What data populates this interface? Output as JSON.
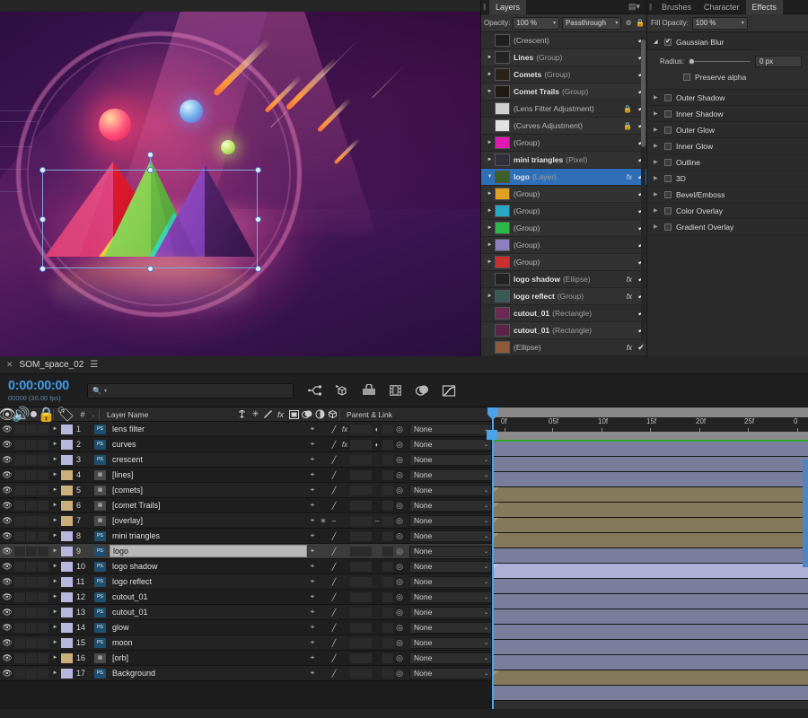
{
  "canvas": {
    "name": "artboard-canvas",
    "selection": {
      "handles": 8,
      "rotation_handle": true
    }
  },
  "layers_panel": {
    "tab": "Layers",
    "menu_icon": "panel-menu-icon",
    "opacity_label": "Opacity:",
    "opacity_value": "100 %",
    "blend_mode": "Passthrough",
    "gear_icon": "gear-icon",
    "lock_icon": "lock-icon",
    "items": [
      {
        "name": "(Crescent)",
        "type": "",
        "bold": false,
        "expandable": false,
        "fx": false,
        "locked": false,
        "checked": "✔",
        "thumb": "#1f1f1f"
      },
      {
        "name": "Lines",
        "type": "(Group)",
        "bold": true,
        "expandable": true,
        "fx": false,
        "locked": false,
        "checked": "✔",
        "thumb": "#242424"
      },
      {
        "name": "Comets",
        "type": "(Group)",
        "bold": true,
        "expandable": true,
        "fx": false,
        "locked": false,
        "checked": "✔",
        "thumb": "#2a2118"
      },
      {
        "name": "Comet Trails",
        "type": "(Group)",
        "bold": true,
        "expandable": true,
        "fx": false,
        "locked": false,
        "checked": "✔",
        "thumb": "#201a14"
      },
      {
        "name": "(Lens Filter Adjustment)",
        "type": "",
        "bold": false,
        "expandable": false,
        "fx": false,
        "locked": true,
        "checked": "✔",
        "thumb": "#cfcfcf"
      },
      {
        "name": "(Curves Adjustment)",
        "type": "",
        "bold": false,
        "expandable": false,
        "fx": false,
        "locked": true,
        "checked": "✔",
        "thumb": "#e2e2e2"
      },
      {
        "name": "(Group)",
        "type": "",
        "bold": false,
        "expandable": true,
        "fx": false,
        "locked": false,
        "checked": "✔",
        "thumb": "#e01ab0"
      },
      {
        "name": "mini triangles",
        "type": "(Pixel)",
        "bold": true,
        "expandable": true,
        "fx": false,
        "locked": false,
        "checked": "✔",
        "thumb": "#30303a"
      },
      {
        "name": "logo",
        "type": "(Layer)",
        "bold": true,
        "expandable": true,
        "fx": true,
        "locked": false,
        "checked": "✔",
        "thumb": "#3b5e2a",
        "selected": true
      },
      {
        "name": "(Group)",
        "type": "",
        "bold": false,
        "expandable": true,
        "fx": false,
        "locked": false,
        "checked": "✔",
        "thumb": "#e0a020"
      },
      {
        "name": "(Group)",
        "type": "",
        "bold": false,
        "expandable": true,
        "fx": false,
        "locked": false,
        "checked": "✔",
        "thumb": "#2aa8c8"
      },
      {
        "name": "(Group)",
        "type": "",
        "bold": false,
        "expandable": true,
        "fx": false,
        "locked": false,
        "checked": "✔",
        "thumb": "#2fb84a"
      },
      {
        "name": "(Group)",
        "type": "",
        "bold": false,
        "expandable": true,
        "fx": false,
        "locked": false,
        "checked": "✔",
        "thumb": "#8b7fc0"
      },
      {
        "name": "(Group)",
        "type": "",
        "bold": false,
        "expandable": true,
        "fx": false,
        "locked": false,
        "checked": "✔",
        "thumb": "#c83030"
      },
      {
        "name": "logo shadow",
        "type": "(Ellipse)",
        "bold": true,
        "expandable": false,
        "fx": true,
        "locked": false,
        "checked": "✔",
        "thumb": "#232323"
      },
      {
        "name": "logo reflect",
        "type": "(Group)",
        "bold": true,
        "expandable": true,
        "fx": true,
        "locked": false,
        "checked": "✔",
        "thumb": "#3a5a58"
      },
      {
        "name": "cutout_01",
        "type": "(Rectangle)",
        "bold": true,
        "expandable": false,
        "fx": false,
        "locked": false,
        "checked": "✔",
        "thumb": "#6b2a52"
      },
      {
        "name": "cutout_01",
        "type": "(Rectangle)",
        "bold": true,
        "expandable": false,
        "fx": false,
        "locked": false,
        "checked": "✔",
        "thumb": "#5a2448"
      },
      {
        "name": "(Ellipse)",
        "type": "",
        "bold": false,
        "expandable": false,
        "fx": true,
        "locked": false,
        "checked": "✔",
        "thumb": "#8a5a3a"
      }
    ]
  },
  "effects_panel": {
    "tabs": [
      "Brushes",
      "Character",
      "Effects"
    ],
    "active_tab": "Effects",
    "fill_opacity_label": "Fill Opacity:",
    "fill_opacity_value": "100 %",
    "gaussian_blur": {
      "label": "Gaussian Blur",
      "enabled": true,
      "expanded": true,
      "radius_label": "Radius:",
      "radius_value": "0 px",
      "preserve_alpha_label": "Preserve alpha",
      "preserve_alpha_enabled": false
    },
    "effects": [
      {
        "label": "Outer Shadow",
        "enabled": false
      },
      {
        "label": "Inner Shadow",
        "enabled": false
      },
      {
        "label": "Outer Glow",
        "enabled": false
      },
      {
        "label": "Inner Glow",
        "enabled": false
      },
      {
        "label": "Outline",
        "enabled": false
      },
      {
        "label": "3D",
        "enabled": false
      },
      {
        "label": "Bevel/Emboss",
        "enabled": false
      },
      {
        "label": "Color Overlay",
        "enabled": false
      },
      {
        "label": "Gradient Overlay",
        "enabled": false
      }
    ]
  },
  "timeline": {
    "close_icon": "close-icon",
    "comp_name": "SOM_space_02",
    "menu_icon": "hamburger-icon",
    "timecode": "0:00:00:00",
    "timecode_sub": "00000 (30.00 fps)",
    "search_placeholder": "",
    "search_value": "",
    "tools": [
      "graph-editor-icon",
      "motion-3d-icon",
      "composition-icon",
      "footage-icon",
      "layers-stack-icon",
      "graph-curve-icon"
    ],
    "column_headers": {
      "eye": "video-toggle-icon",
      "audio": "audio-toggle-icon",
      "solo": "solo-icon",
      "lock": "lock-icon",
      "label": "label-icon",
      "number": "#",
      "layer_name": "Layer Name",
      "switches": [
        "shy-icon",
        "collapse-icon",
        "quality-icon",
        "fx-icon",
        "frame-blend-icon",
        "motion-blur-icon",
        "adjustment-icon",
        "3d-icon"
      ],
      "parent_link": "Parent & Link"
    },
    "ruler_ticks": [
      "0f",
      "05f",
      "10f",
      "15f",
      "20f",
      "25f",
      "0"
    ],
    "rows": [
      {
        "num": "1",
        "name": "lens filter",
        "source": "ps",
        "color": "#b6b8dd",
        "track": "purple",
        "fx": true,
        "quality": true,
        "adj": true,
        "parent": "None"
      },
      {
        "num": "2",
        "name": "curves",
        "source": "ps",
        "color": "#b6b8dd",
        "track": "purple",
        "fx": true,
        "quality": true,
        "adj": true,
        "parent": "None"
      },
      {
        "num": "3",
        "name": "crescent",
        "source": "ps",
        "color": "#b6b8dd",
        "track": "purple",
        "fx": false,
        "quality": true,
        "adj": false,
        "parent": "None"
      },
      {
        "num": "4",
        "name": "[lines]",
        "source": "img",
        "color": "#cbb07c",
        "track": "tan",
        "fx": false,
        "quality": true,
        "adj": false,
        "parent": "None"
      },
      {
        "num": "5",
        "name": "[comets]",
        "source": "img",
        "color": "#cbb07c",
        "track": "tan",
        "fx": false,
        "quality": true,
        "adj": false,
        "parent": "None"
      },
      {
        "num": "6",
        "name": "[comet Trails]",
        "source": "img",
        "color": "#cbb07c",
        "track": "tan",
        "fx": false,
        "quality": true,
        "adj": false,
        "parent": "None"
      },
      {
        "num": "7",
        "name": "[overlay]",
        "source": "img",
        "color": "#cbb07c",
        "track": "tan",
        "fx": false,
        "quality": false,
        "adj": false,
        "parent": "None"
      },
      {
        "num": "8",
        "name": "mini triangles",
        "source": "ps",
        "color": "#b6b8dd",
        "track": "purple",
        "fx": false,
        "quality": true,
        "adj": false,
        "parent": "None"
      },
      {
        "num": "9",
        "name": "logo",
        "source": "ps",
        "color": "#b6b8dd",
        "track": "sel",
        "fx": false,
        "quality": true,
        "adj": false,
        "parent": "None",
        "selected": true
      },
      {
        "num": "10",
        "name": "logo shadow",
        "source": "ps",
        "color": "#b6b8dd",
        "track": "purple",
        "fx": false,
        "quality": true,
        "adj": false,
        "parent": "None"
      },
      {
        "num": "11",
        "name": "logo reflect",
        "source": "ps",
        "color": "#b6b8dd",
        "track": "purple",
        "fx": false,
        "quality": true,
        "adj": false,
        "parent": "None"
      },
      {
        "num": "12",
        "name": "cutout_01",
        "source": "ps",
        "color": "#b6b8dd",
        "track": "purple",
        "fx": false,
        "quality": true,
        "adj": false,
        "parent": "None"
      },
      {
        "num": "13",
        "name": "cutout_01",
        "source": "ps",
        "color": "#b6b8dd",
        "track": "purple",
        "fx": false,
        "quality": true,
        "adj": false,
        "parent": "None"
      },
      {
        "num": "14",
        "name": "glow",
        "source": "ps",
        "color": "#b6b8dd",
        "track": "purple",
        "fx": false,
        "quality": true,
        "adj": false,
        "parent": "None"
      },
      {
        "num": "15",
        "name": "moon",
        "source": "ps",
        "color": "#b6b8dd",
        "track": "purple",
        "fx": false,
        "quality": true,
        "adj": false,
        "parent": "None"
      },
      {
        "num": "16",
        "name": "[orb]",
        "source": "img",
        "color": "#cbb07c",
        "track": "tan",
        "fx": false,
        "quality": true,
        "adj": false,
        "parent": "None"
      },
      {
        "num": "17",
        "name": "Background",
        "source": "ps",
        "color": "#b6b8dd",
        "track": "purple",
        "fx": false,
        "quality": true,
        "adj": false,
        "parent": "None"
      }
    ]
  },
  "colors": {
    "accent_blue": "#3f9be8",
    "selection_blue": "#2f6fb8",
    "track_purple": "#7a7e9c",
    "track_tan": "#85795c",
    "green_line": "#2fa82f"
  }
}
